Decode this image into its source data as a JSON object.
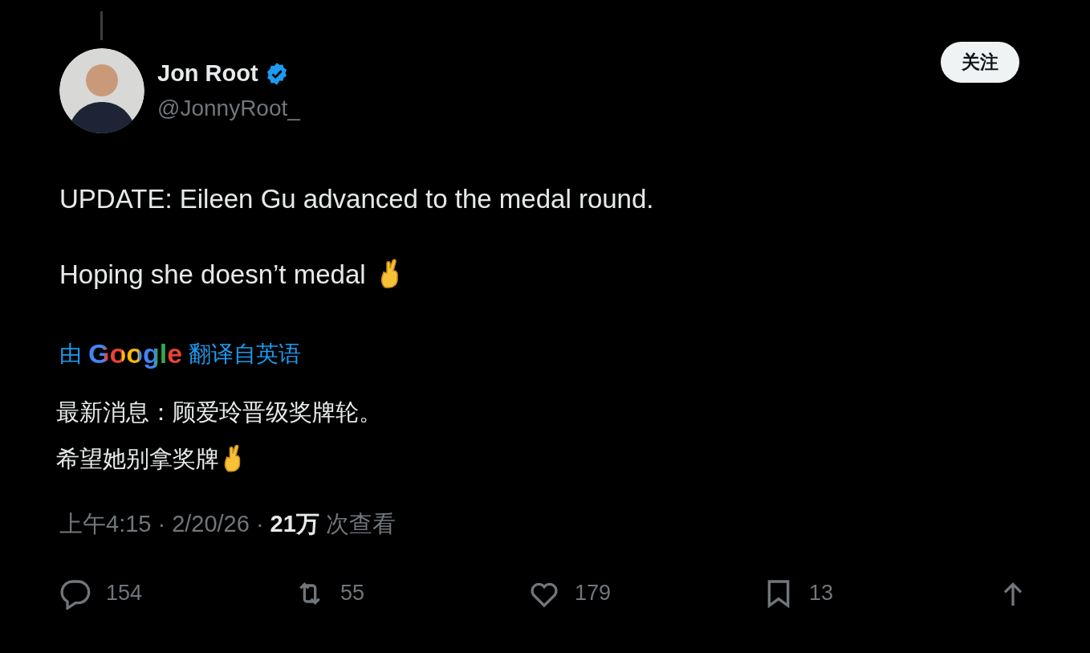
{
  "author": {
    "name": "Jon Root",
    "verified": true,
    "handle": "@JonnyRoot_"
  },
  "follow_button": "关注",
  "post": {
    "paragraphs": [
      "UPDATE: Eileen Gu advanced to the medal round.",
      "Hoping she doesn’t medal"
    ]
  },
  "translation": {
    "prefix": "由",
    "brand": "Google",
    "suffix": "翻译自英语",
    "lines": [
      "最新消息：顾爱玲晋级奖牌轮。",
      "希望她别拿奖牌"
    ]
  },
  "meta": {
    "time": "上午4:15",
    "separator_1": "·",
    "date": "2/20/26",
    "separator_2": "·",
    "views": "21万",
    "views_label": "次查看"
  },
  "actions": [
    {
      "kind": "reply",
      "count": "154"
    },
    {
      "kind": "repost",
      "count": "55"
    },
    {
      "kind": "like",
      "count": "179"
    },
    {
      "kind": "bookmark",
      "count": "13"
    },
    {
      "kind": "share"
    }
  ]
}
